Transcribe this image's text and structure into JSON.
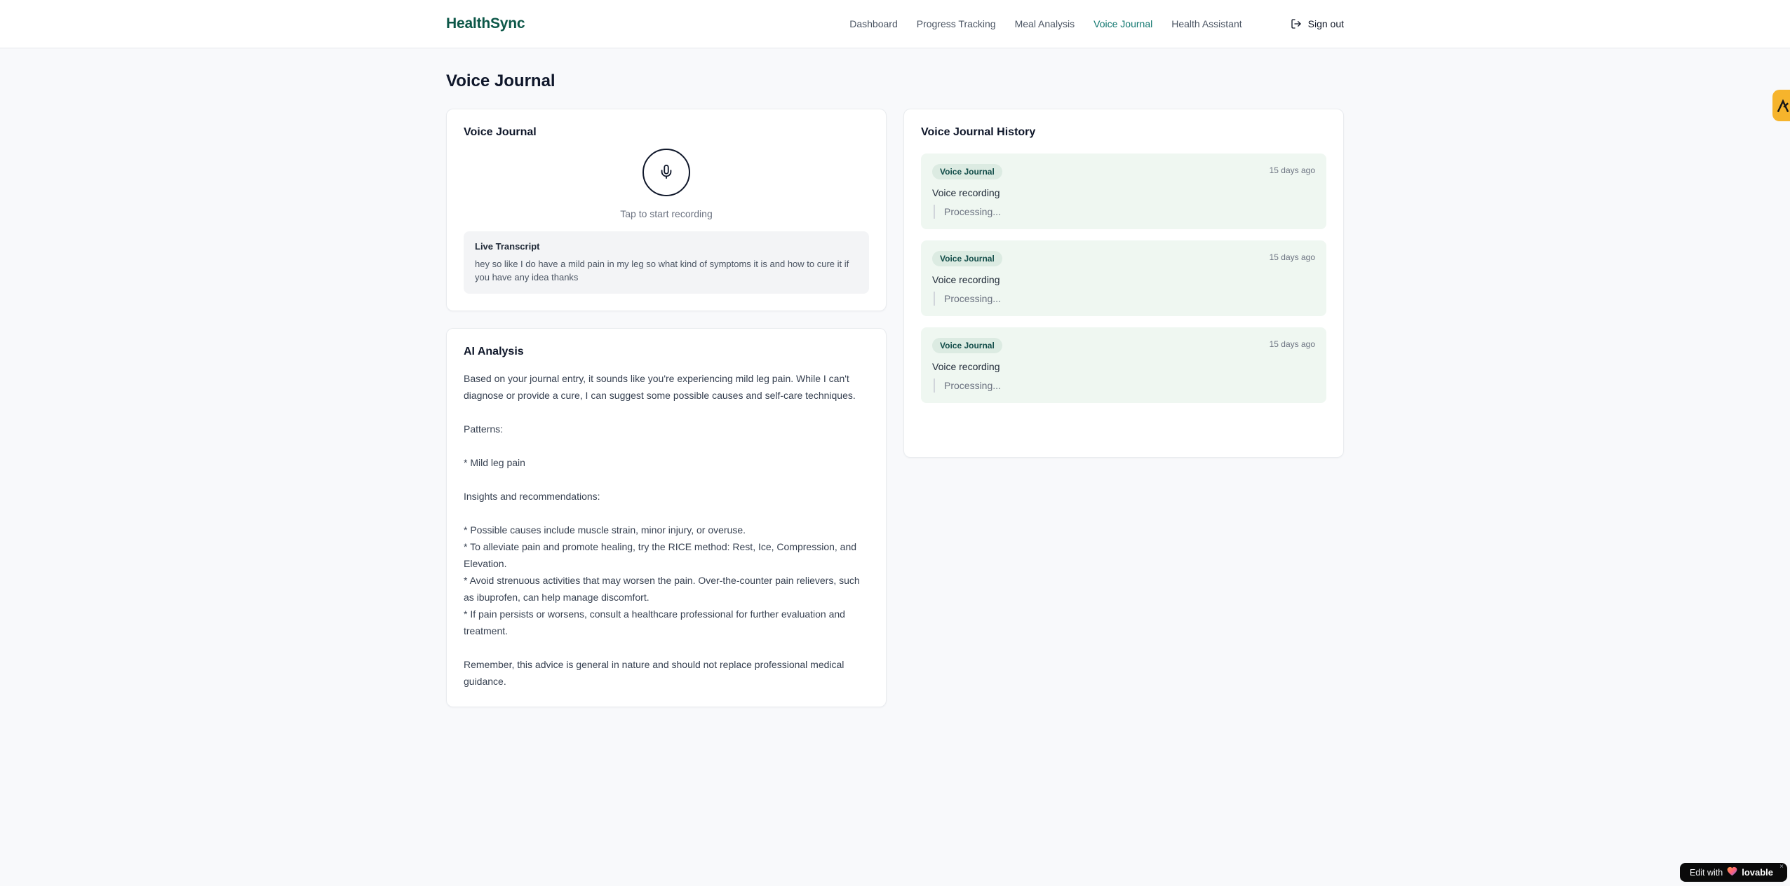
{
  "brand": "HealthSync",
  "nav": {
    "items": [
      {
        "label": "Dashboard"
      },
      {
        "label": "Progress Tracking"
      },
      {
        "label": "Meal Analysis"
      },
      {
        "label": "Voice Journal"
      },
      {
        "label": "Health Assistant"
      }
    ],
    "active_item": "Voice Journal",
    "sign_out_label": "Sign out"
  },
  "page": {
    "title": "Voice Journal"
  },
  "recorder": {
    "card_title": "Voice Journal",
    "tap_label": "Tap to start recording",
    "transcript_title": "Live Transcript",
    "transcript_text": "hey so like I do have a mild pain in my leg so what kind of symptoms it is and how to cure it if you have any idea thanks"
  },
  "analysis": {
    "card_title": "AI Analysis",
    "body": "Based on your journal entry, it sounds like you're experiencing mild leg pain. While I can't diagnose or provide a cure, I can suggest some possible causes and self-care techniques.\n\nPatterns:\n\n* Mild leg pain\n\nInsights and recommendations:\n\n* Possible causes include muscle strain, minor injury, or overuse.\n* To alleviate pain and promote healing, try the RICE method: Rest, Ice, Compression, and Elevation.\n* Avoid strenuous activities that may worsen the pain. Over-the-counter pain relievers, such as ibuprofen, can help manage discomfort.\n* If pain persists or worsens, consult a healthcare professional for further evaluation and treatment.\n\nRemember, this advice is general in nature and should not replace professional medical guidance."
  },
  "history": {
    "card_title": "Voice Journal History",
    "items": [
      {
        "badge": "Voice Journal",
        "time": "15 days ago",
        "title": "Voice recording",
        "status": "Processing..."
      },
      {
        "badge": "Voice Journal",
        "time": "15 days ago",
        "title": "Voice recording",
        "status": "Processing..."
      },
      {
        "badge": "Voice Journal",
        "time": "15 days ago",
        "title": "Voice recording",
        "status": "Processing..."
      }
    ]
  },
  "widgets": {
    "edit_badge": {
      "prefix": "Edit with",
      "brand": "lovable",
      "close": "×"
    }
  },
  "colors": {
    "brand_green": "#0c5748",
    "active_nav_teal": "#0f766e",
    "history_item_bg": "#eff7f1",
    "badge_bg": "#dcebe2",
    "badge_text": "#134e4a",
    "side_badge_yellow": "#f6b42c",
    "edit_badge_black": "#0a0a0a"
  }
}
